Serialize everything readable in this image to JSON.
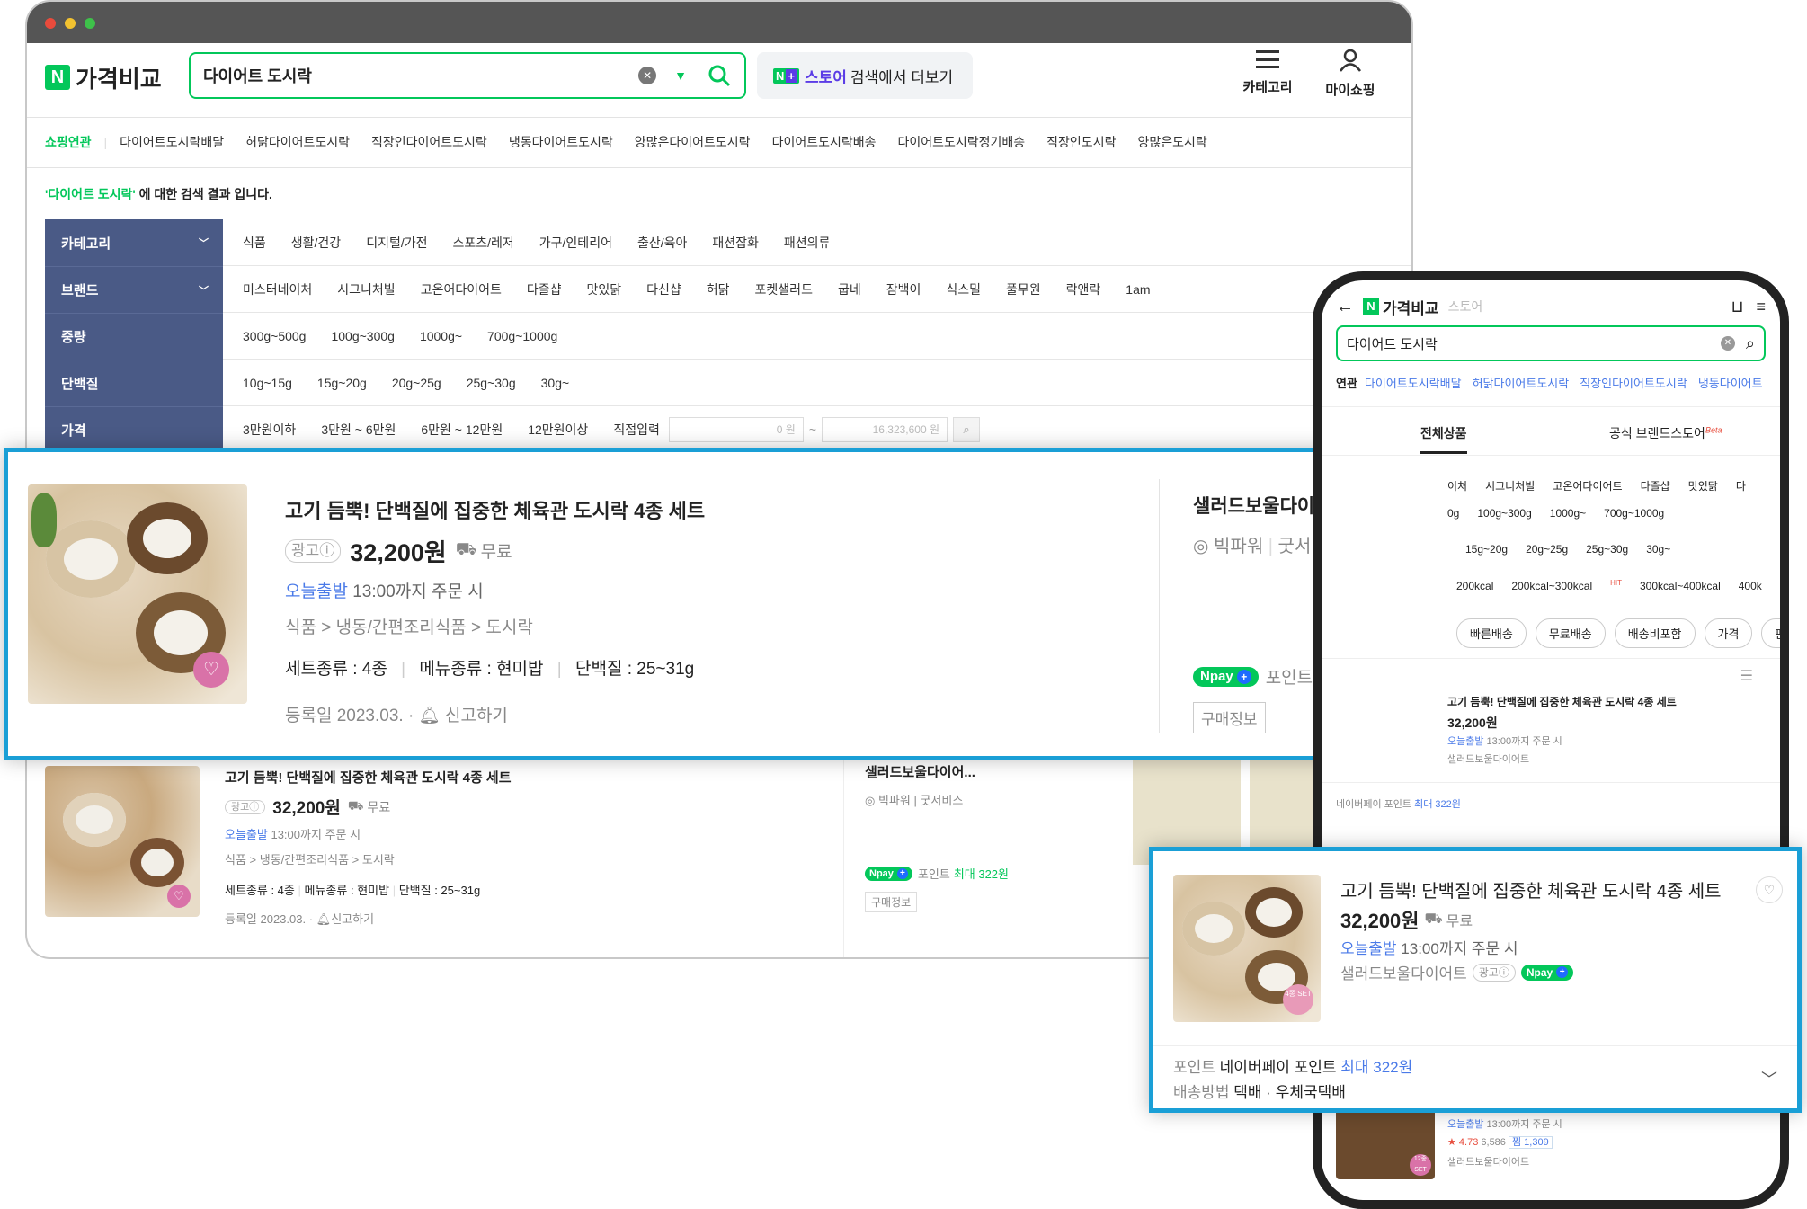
{
  "header": {
    "logo_text": "가격비교",
    "search_value": "다이어트 도시락",
    "store_more": "검색에서 더보기",
    "store_brand": "스토어",
    "category_label": "카테고리",
    "myshopping_label": "마이쇼핑"
  },
  "related": {
    "label": "쇼핑연관",
    "items": [
      "다이어트도시락배달",
      "허닭다이어트도시락",
      "직장인다이어트도시락",
      "냉동다이어트도시락",
      "양많은다이어트도시락",
      "다이어트도시락배송",
      "다이어트도시락정기배송",
      "직장인도시락",
      "양많은도시락"
    ]
  },
  "result_msg": {
    "query": "'다이어트 도시락'",
    "suffix": " 에 대한 검색 결과 입니다."
  },
  "filters": [
    {
      "label": "카테고리",
      "items": [
        "식품",
        "생활/건강",
        "디지털/가전",
        "스포츠/레저",
        "가구/인테리어",
        "출산/육아",
        "패션잡화",
        "패션의류"
      ]
    },
    {
      "label": "브랜드",
      "items": [
        "미스터네이처",
        "시그니처빌",
        "고온어다이어트",
        "다즐샵",
        "맛있닭",
        "다신샵",
        "허닭",
        "포켓샐러드",
        "굽네",
        "잠백이",
        "식스밀",
        "풀무원",
        "락앤락",
        "1am"
      ]
    },
    {
      "label": "중량",
      "items": [
        "300g~500g",
        "100g~300g",
        "1000g~",
        "700g~1000g"
      ]
    },
    {
      "label": "단백질",
      "items": [
        "10g~15g",
        "15g~20g",
        "20g~25g",
        "25g~30g",
        "30g~"
      ]
    },
    {
      "label": "가격",
      "items": [
        "3만원이하",
        "3만원 ~ 6만원",
        "6만원 ~ 12만원",
        "12만원이상",
        "직접입력"
      ]
    }
  ],
  "price_range": {
    "min_placeholder": "0 원",
    "tilde": "~",
    "max_placeholder": "16,323,600 원"
  },
  "product": {
    "title": "고기 듬뿍! 단백질에 집중한 체육관 도시락 4종 세트",
    "ad_badge": "광고ⓘ",
    "price": "32,200원",
    "shipping": "무료",
    "today_ship": "오늘출발",
    "ship_time": "13:00까지 주문 시",
    "category_path": [
      "식품",
      "냉동/간편조리식품",
      "도시락"
    ],
    "specs": [
      "세트종류 : 4종",
      "메뉴종류 : 현미밥",
      "단백질 : 25~31g"
    ],
    "reg_date": "등록일 2023.03.",
    "report": "신고하기",
    "seller": "샐러드보울다이어...",
    "seller_full": "샐러드보울다이어트",
    "seller_grade": "빅파워",
    "seller_service": "굿서비스",
    "npay_point_label": "포인트",
    "npay_point_max": "최대 322원",
    "buy_info": "구매정보",
    "npay_text": "pay"
  },
  "phone": {
    "logo_text": "가격비교",
    "store_text": "스토어",
    "search_value": "다이어트 도시락",
    "related_label": "연관",
    "related_items": [
      "다이어트도시락배달",
      "허닭다이어트도시락",
      "직장인다이어트도시락",
      "냉동다이어트"
    ],
    "tab_all": "전체상품",
    "tab_brand": "공식 브랜드스토어",
    "beta": "Beta",
    "brand_row": [
      "이처",
      "시그니처빌",
      "고온어다이어트",
      "다즐샵",
      "맛있닭",
      "다"
    ],
    "weight_row": [
      "0g",
      "100g~300g",
      "1000g~",
      "700g~1000g"
    ],
    "protein_row": [
      "15g~20g",
      "20g~25g",
      "25g~30g",
      "30g~"
    ],
    "kcal_row": [
      "200kcal",
      "200kcal~300kcal",
      "300kcal~400kcal",
      "400k"
    ],
    "hit": "HIT",
    "chips": [
      "빠른배송",
      "무료배송",
      "배송비포함",
      "가격",
      "판"
    ],
    "point_label": "포인트",
    "point_text": "네이버페이 포인트",
    "point_max": "최대 322원",
    "delivery_label": "배송방법",
    "delivery_text": "택배",
    "delivery_sep": "·",
    "delivery_post": "우체국택배",
    "rating": "★ 4.73",
    "rating_count": "6,586",
    "jjim": "찜 1,309",
    "set_badge": "4종 SET",
    "set_badge2": "12종 SET"
  },
  "colors": {
    "naver_green": "#03c75a",
    "highlight_blue": "#1a9fd6",
    "sidebar": "#4a5a86",
    "link_blue": "#4a7ae8"
  }
}
